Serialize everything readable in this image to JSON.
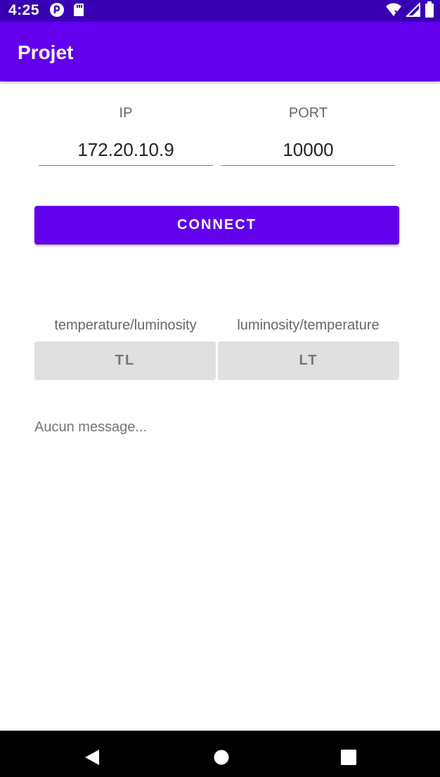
{
  "status_bar": {
    "time": "4:25",
    "icons": [
      "data-saver-icon",
      "sd-card-icon",
      "wifi-off-icon",
      "signal-icon",
      "battery-icon"
    ]
  },
  "app_bar": {
    "title": "Projet"
  },
  "ip_field": {
    "label": "IP",
    "value": "172.20.10.9"
  },
  "port_field": {
    "label": "PORT",
    "value": "10000"
  },
  "connect_button": {
    "label": "CONNECT"
  },
  "tl": {
    "caption": "temperature/luminosity",
    "button_label": "TL"
  },
  "lt": {
    "caption": "luminosity/temperature",
    "button_label": "LT"
  },
  "message": "Aucun message...",
  "nav_bar": {
    "icons": [
      "back-icon",
      "home-icon",
      "recents-icon"
    ]
  },
  "colors": {
    "primary": "#6200ee",
    "primary_dark": "#3700b3",
    "button_grey": "#e0e0e0"
  }
}
